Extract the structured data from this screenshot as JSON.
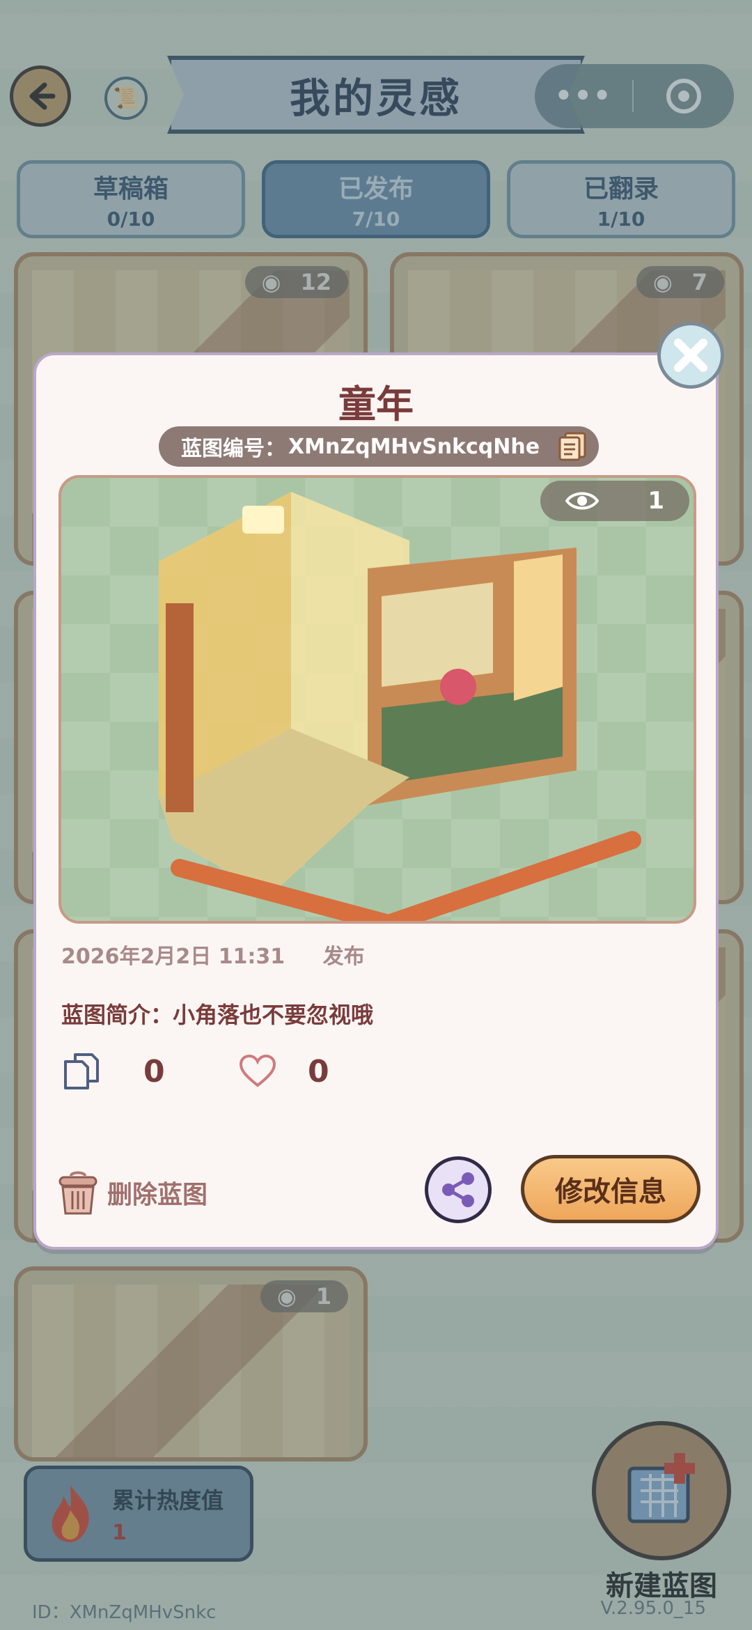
{
  "header": {
    "title": "我的灵感",
    "capsule_more": "•••"
  },
  "tabs": [
    {
      "label": "草稿箱",
      "count": "0/10",
      "active": false
    },
    {
      "label": "已发布",
      "count": "7/10",
      "active": true
    },
    {
      "label": "已翻录",
      "count": "1/10",
      "active": false
    }
  ],
  "background_cards": [
    {
      "views": "12"
    },
    {
      "views": "7"
    },
    {
      "views": "1"
    }
  ],
  "modal": {
    "title": "童年",
    "code_label": "蓝图编号：",
    "code_value": "XMnZqMHvSnkcqNhe",
    "preview_views": "1",
    "date": "2026年2月2日 11:31",
    "status": "发布",
    "description": "蓝图简介：小角落也不要忽视哦",
    "copies": "0",
    "likes": "0",
    "delete_label": "删除蓝图",
    "edit_label": "修改信息"
  },
  "heat": {
    "label": "累计热度值",
    "value": "1"
  },
  "new_blueprint_label": "新建蓝图",
  "footer": {
    "id_text": "ID：XMnZqMHvSnkc",
    "version": "V.2.95.0_15"
  },
  "colors": {
    "modal_text": "#7a3b3b",
    "edit_button": "#eea75b",
    "tab_active": "#6f90ad"
  }
}
